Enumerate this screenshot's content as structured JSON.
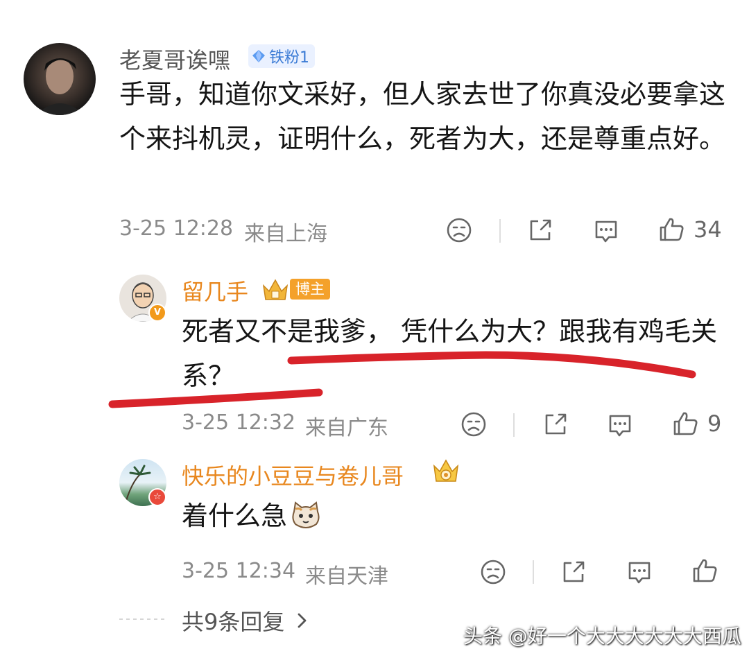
{
  "comment": {
    "author": "老夏哥诶嘿",
    "badge": "铁粉1",
    "text": "手哥，知道你文采好，但人家去世了你真没必要拿这个来抖机灵，证明什么，死者为大，还是尊重点好。",
    "time": "3-25 12:28",
    "location": "来自上海",
    "likes": "34"
  },
  "replies": [
    {
      "author": "留几手",
      "badge": "博主",
      "text": "死者又不是我爹， 凭什么为大？跟我有鸡毛关系？",
      "time": "3-25 12:32",
      "location": "来自广东",
      "likes": "9"
    },
    {
      "author": "快乐的小豆豆与卷儿哥",
      "text": "着什么急",
      "time": "3-25 12:34",
      "location": "来自天津",
      "likes": ""
    }
  ],
  "more_replies": "共9条回复",
  "watermark": "头条 @好一个大大大大大大西瓜",
  "colors": {
    "underline": "#d8232a",
    "host_name": "#e8871e",
    "fan_badge": "#3a7bd5"
  }
}
